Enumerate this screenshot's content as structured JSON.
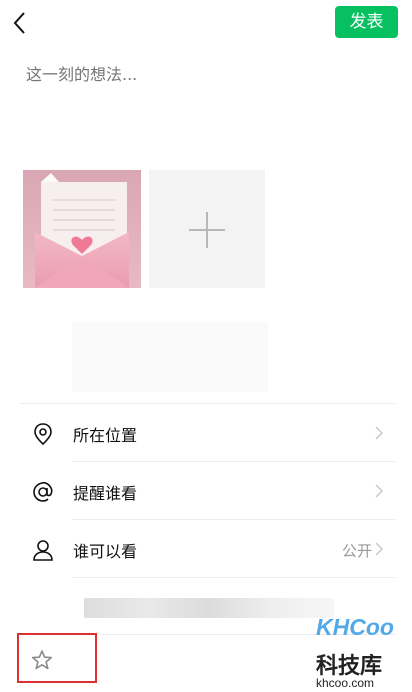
{
  "header": {
    "publish_label": "发表"
  },
  "composer": {
    "placeholder": "这一刻的想法..."
  },
  "options": [
    {
      "label": "所在位置",
      "icon": "location-pin-icon"
    },
    {
      "label": "提醒谁看",
      "icon": "at-sign-icon"
    },
    {
      "label": "谁可以看",
      "icon": "person-icon",
      "value": "公开"
    }
  ],
  "watermark": {
    "brand": "KHCoo",
    "name": "科技库",
    "url": "khcoo.com"
  },
  "colors": {
    "accent": "#07c160",
    "highlight_border": "#e0302d"
  }
}
